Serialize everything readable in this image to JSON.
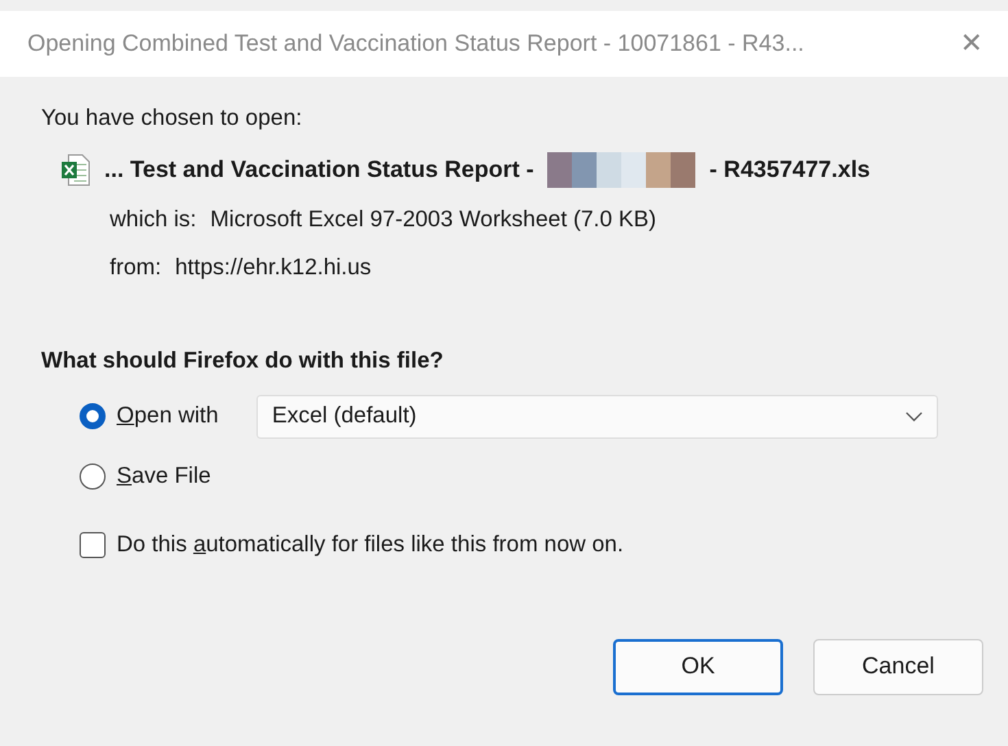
{
  "window": {
    "title": "Opening Combined Test and Vaccination Status Report - 10071861 - R43...",
    "close": "✕"
  },
  "intro": "You have chosen to open:",
  "file": {
    "name_start": "... Test and Vaccination Status Report -",
    "redacted": true,
    "name_end": "- R4357477.xls"
  },
  "details": [
    {
      "label": "which is:",
      "value": "Microsoft Excel 97-2003 Worksheet (7.0 KB)"
    },
    {
      "label": "from:",
      "value": "https://ehr.k12.hi.us"
    }
  ],
  "question": "What should Firefox do with this file?",
  "options": [
    {
      "kind": "app",
      "key": "O",
      "after": "pen with",
      "selected": true,
      "app": "Excel (default)"
    },
    {
      "kind": "plain",
      "key": "S",
      "after": "ave File",
      "selected": false
    }
  ],
  "auto": {
    "before": "Do this ",
    "key": "a",
    "after": "utomatically for files like this from now on.",
    "checked": false
  },
  "buttons": [
    {
      "label": "OK",
      "default": true
    },
    {
      "label": "Cancel",
      "default": false
    }
  ]
}
